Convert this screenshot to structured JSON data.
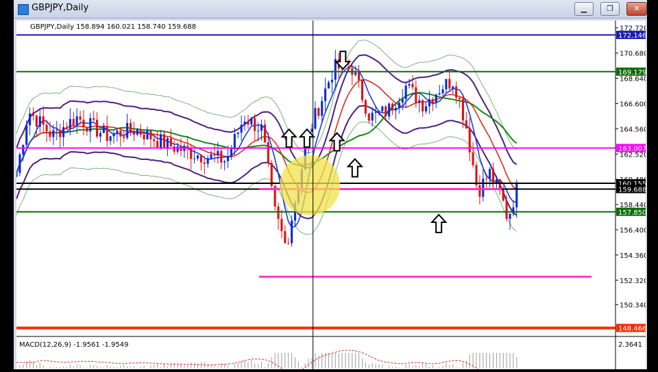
{
  "window": {
    "title": "GBPJPY,Daily",
    "min_glyph": "▁",
    "max_glyph": "❐",
    "close_glyph": "✕"
  },
  "chart_data": {
    "type": "candlestick",
    "symbol_info": "GBPJPY,Daily  158.894 160.021 158.740 159.688",
    "price_axis": {
      "ylim": [
        148.0,
        173.2
      ],
      "ticks": [
        172.72,
        170.68,
        168.64,
        166.6,
        164.56,
        162.52,
        160.48,
        158.44,
        156.4,
        154.36,
        152.32,
        150.34
      ],
      "tick_labels": [
        "172.720",
        "170.680",
        "168.640",
        "166.600",
        "164.560",
        "162.520",
        "160.480",
        "158.440",
        "156.400",
        "154.360",
        "152.320",
        "150.340"
      ]
    },
    "horizontal_levels": [
      {
        "price": 172.146,
        "label": "172.146",
        "color": "#1c1cb4"
      },
      {
        "price": 169.179,
        "label": "169.179",
        "color": "#0e6b0e"
      },
      {
        "price": 163.007,
        "label": "163.007",
        "color": "#ff00ff"
      },
      {
        "price": 160.155,
        "label": "160.155",
        "color": "#000000"
      },
      {
        "price": 159.688,
        "label": "159.688",
        "color": "#000000"
      },
      {
        "price": 157.85,
        "label": "157.850",
        "color": "#0e6b0e"
      },
      {
        "price": 148.466,
        "label": "148.466",
        "color": "#ff2a00"
      }
    ],
    "drawn_segments": [
      {
        "price": 159.688,
        "x_from": 0.405,
        "x_to": 0.81,
        "color": "#ff33cc"
      },
      {
        "price": 152.6,
        "x_from": 0.405,
        "x_to": 0.96,
        "color": "#ff33cc"
      }
    ],
    "highlight_circle": {
      "price": 160.0,
      "x": 0.49,
      "color": "#f2e14a"
    },
    "arrows": [
      {
        "direction": "down",
        "x": 0.545,
        "price": 170.1
      },
      {
        "direction": "up",
        "x": 0.455,
        "price": 163.8
      },
      {
        "direction": "up",
        "x": 0.485,
        "price": 163.8
      },
      {
        "direction": "up",
        "x": 0.535,
        "price": 163.5
      },
      {
        "direction": "up",
        "x": 0.565,
        "price": 161.4
      },
      {
        "direction": "up",
        "x": 0.705,
        "price": 156.9
      }
    ],
    "crosshair_x": 0.495,
    "macd": {
      "label": "MACD(12,26,9) -1.9561 -1.9549",
      "tick_label": "2.3641"
    },
    "legend": "none",
    "grid": false
  }
}
